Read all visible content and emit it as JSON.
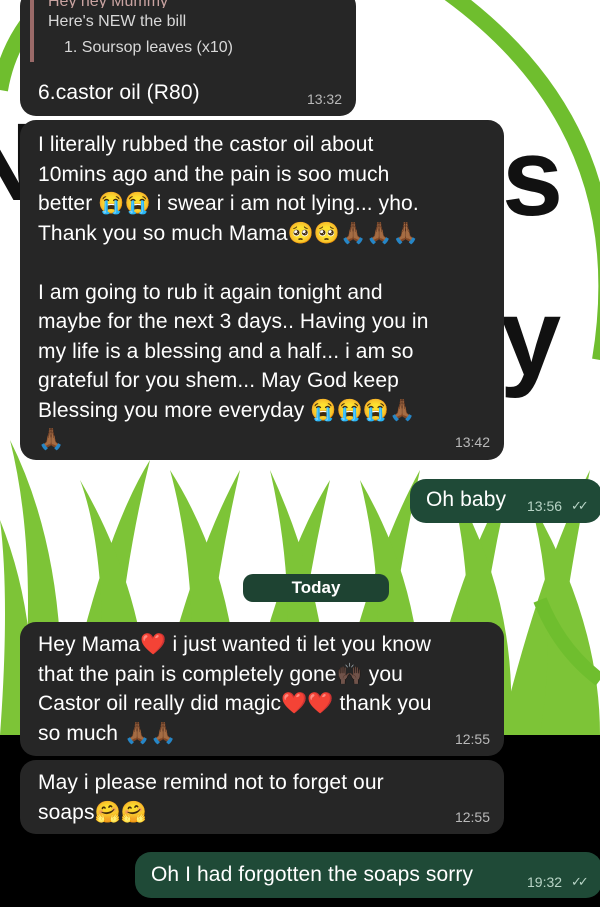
{
  "chat": {
    "quoted": {
      "author_partial": "Hey hey Mummy",
      "line1": "Here's NEW the bill",
      "line2": "1. Soursop leaves (x10)"
    },
    "messages": [
      {
        "id": "m1",
        "direction": "incoming",
        "text": "6.castor oil (R80)",
        "time": "13:32"
      },
      {
        "id": "m2",
        "direction": "incoming",
        "lines": [
          "I literally rubbed the castor oil about",
          "10mins ago and the pain is soo much",
          "better 😭😭 i swear i am not lying... yho.",
          "Thank you so much Mama🥺🥺🙏🏾🙏🏾🙏🏾",
          "",
          "I am going to rub it again tonight and",
          "maybe for the next 3 days.. Having you in",
          "my life is a blessing and a half... i am so",
          "grateful for you shem... May God keep",
          "Blessing you more everyday 😭😭😭🙏🏾",
          "🙏🏾"
        ],
        "time": "13:42"
      },
      {
        "id": "m3",
        "direction": "outgoing",
        "text": "Oh baby",
        "time": "13:56"
      },
      {
        "id": "m4",
        "direction": "incoming",
        "lines": [
          "Hey Mama❤️ i just wanted ti let you know",
          "that the pain is completely gone🙌🏿 you",
          "Castor oil really did magic❤️❤️ thank you",
          "so much 🙏🏾🙏🏾"
        ],
        "time": "12:55"
      },
      {
        "id": "m5",
        "direction": "incoming",
        "lines": [
          "May i please remind not to forget our",
          "soaps🤗🤗"
        ],
        "time": "12:55"
      },
      {
        "id": "m6",
        "direction": "outgoing",
        "text": "Oh I had forgotten the soaps sorry",
        "time": "19:32"
      }
    ],
    "date_separator": "Today",
    "read_ticks": "✓✓"
  },
  "colors": {
    "incoming_bubble": "#262626",
    "outgoing_bubble": "#1f4a37",
    "wallpaper_grass": "#6fbe2e",
    "wallpaper_bg": "#ffffff"
  }
}
